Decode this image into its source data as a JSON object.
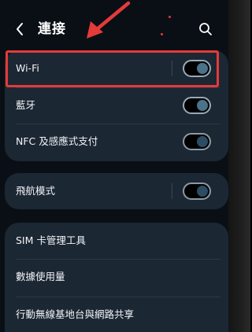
{
  "header": {
    "title": "連接",
    "back_icon": "chevron-left-icon",
    "search_icon": "search-icon"
  },
  "connections": [
    {
      "label": "Wi-Fi",
      "toggle_on": true
    },
    {
      "label": "藍牙",
      "toggle_on": true
    },
    {
      "label": "NFC 及感應式支付",
      "toggle_on": false
    }
  ],
  "airplane": {
    "label": "飛航模式",
    "toggle_on": false
  },
  "more": [
    {
      "label": "SIM 卡管理工具"
    },
    {
      "label": "數據使用量"
    },
    {
      "label": "行動無線基地台與網路共享"
    }
  ],
  "annotation": {
    "color": "#e53a3a",
    "highlight": "Wi-Fi"
  }
}
